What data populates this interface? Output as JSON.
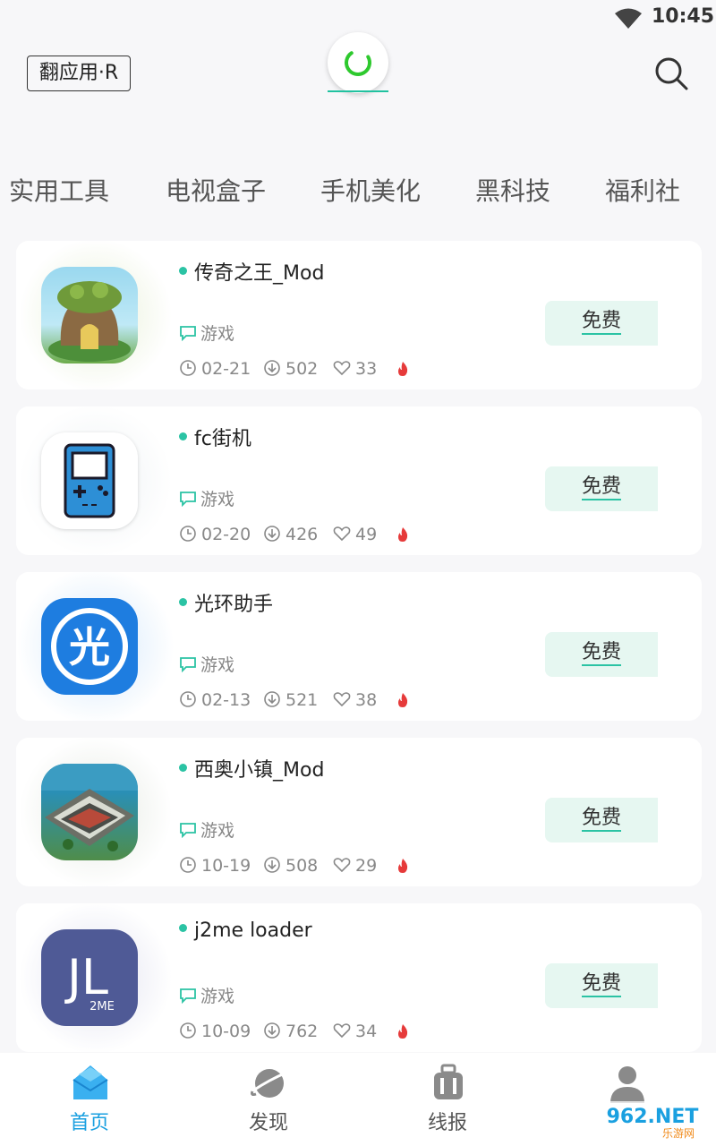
{
  "status_bar": {
    "time": "10:45"
  },
  "header": {
    "brand": "翻应用·R"
  },
  "categories": [
    "实用工具",
    "电视盒子",
    "手机美化",
    "黑科技",
    "福利社"
  ],
  "apps": [
    {
      "name": "传奇之王_Mod",
      "category": "游戏",
      "date": "02-21",
      "downloads": "502",
      "likes": "33",
      "price": "免费"
    },
    {
      "name": "fc街机",
      "category": "游戏",
      "date": "02-20",
      "downloads": "426",
      "likes": "49",
      "price": "免费"
    },
    {
      "name": "光环助手",
      "category": "游戏",
      "date": "02-13",
      "downloads": "521",
      "likes": "38",
      "price": "免费"
    },
    {
      "name": "西奥小镇_Mod",
      "category": "游戏",
      "date": "10-19",
      "downloads": "508",
      "likes": "29",
      "price": "免费"
    },
    {
      "name": "j2me loader",
      "category": "游戏",
      "date": "10-09",
      "downloads": "762",
      "likes": "34",
      "price": "免费"
    }
  ],
  "icon_text": {
    "guanghuan": "光",
    "jl": "JL",
    "jl_sub": "2ME"
  },
  "bottom_nav": [
    {
      "label": "首页",
      "active": true
    },
    {
      "label": "发现",
      "active": false
    },
    {
      "label": "线报",
      "active": false
    }
  ],
  "watermark": {
    "text": "962.NET",
    "sub": "乐游网"
  },
  "colors": {
    "accent": "#2bc3a4",
    "active_nav": "#1aa0e0",
    "free_bg": "#e6f7f1",
    "fire": "#e63a3a"
  }
}
